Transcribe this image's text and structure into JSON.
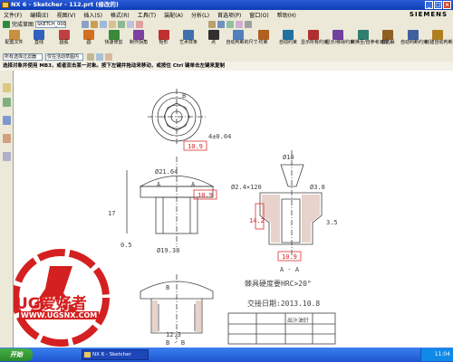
{
  "window": {
    "title": "NX 6 - Sketcher - 112.prt (修改的)"
  },
  "menu": {
    "items": [
      "文件(F)",
      "编辑(E)",
      "视图(V)",
      "插入(S)",
      "格式(R)",
      "工具(T)",
      "装配(A)",
      "分析(L)",
      "首选项(P)",
      "窗口(O)",
      "帮助(H)"
    ],
    "brand": "SIEMENS"
  },
  "toolbar": {
    "finish_sketch": "完成草图",
    "sketch_name": "SKETCH_000",
    "tools": [
      "配置文件",
      "直线",
      "圆弧",
      "圆",
      "快速修剪",
      "制作拐角",
      "矩形",
      "艺术样条",
      "点",
      "自动判断的尺寸",
      "约束",
      "自动约束",
      "显示所有约束",
      "显示/移除约束",
      "转换至/自参考对象",
      "备选解",
      "自动判断约束",
      "创建自动判断约束"
    ],
    "selection_filter": "所有选择过滤器",
    "selection_scope": "仅在活动草图内"
  },
  "cue_line": "选择对象并使用 MB3，或者双击某一对象。按下左键并拖动来移动，或按住 Ctrl 键单击左键来复制",
  "drawing": {
    "dims": [
      "10.9",
      "Ø21.64",
      "10.9",
      "Ø19.38",
      "12.3",
      "Ø10",
      "Ø2.4×120",
      "Ø3.8",
      "10.9",
      "3.5",
      "14.2",
      "17",
      "0.5",
      "4±0.04"
    ],
    "section_labels": [
      "A",
      "A",
      "A - A",
      "B",
      "B",
      "B - B"
    ],
    "note_hardness": "棘具硬度要HRC>20°",
    "note_date": "交接日期:2013.10.8",
    "title_block_name": "出汁油针"
  },
  "watermark": {
    "logo_text": "UG爱好者",
    "url": "WWW.UGSNX.COM"
  },
  "taskbar": {
    "start_label": "开始",
    "app_label": "NX 6 - Sketcher",
    "clock": "11:04"
  },
  "colors": {
    "accent": "#d42020",
    "titlebar": "#0a3db5",
    "canvas_bg": "#ffffff",
    "drawing_line": "#404040"
  }
}
